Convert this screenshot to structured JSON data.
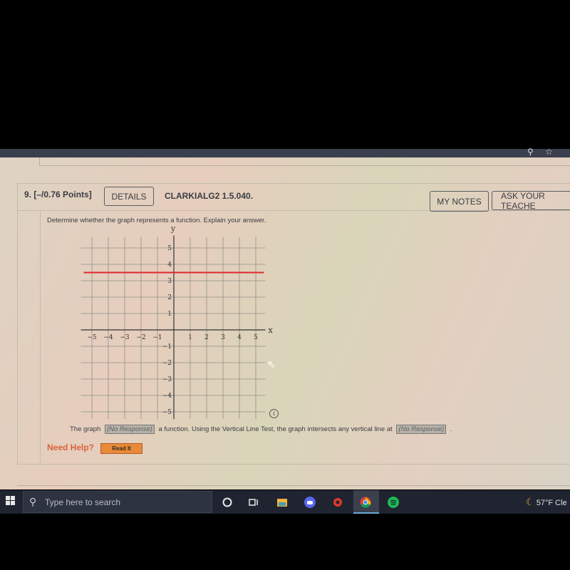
{
  "browser": {
    "icons": [
      "search-icon",
      "star-icon"
    ]
  },
  "question": {
    "number": "9.",
    "points": "[–/0.76 Points]",
    "details_label": "DETAILS",
    "code": "CLARKIALG2 1.5.040.",
    "my_notes_label": "MY NOTES",
    "ask_teacher_label": "ASK YOUR TEACHE",
    "prompt": "Determine whether the graph represents a function. Explain your answer.",
    "sentence_part1": "The graph",
    "blank1": "(No Response)",
    "sentence_part2": "a function. Using the Vertical Line Test, the graph intersects any vertical line at",
    "blank2": "(No Response)",
    "sentence_end": ".",
    "need_help": "Need Help?",
    "read_it": "Read It",
    "info_glyph": "i"
  },
  "chart_data": {
    "type": "line",
    "title": "",
    "xlabel": "x",
    "ylabel": "y",
    "xlim": [
      -5.5,
      5.5
    ],
    "ylim": [
      -5.5,
      5.5
    ],
    "grid": true,
    "x_ticks": [
      -5,
      -4,
      -3,
      -2,
      -1,
      1,
      2,
      3,
      4,
      5
    ],
    "y_ticks": [
      5,
      4,
      3,
      2,
      1,
      -1,
      -2,
      -3,
      -4,
      -5
    ],
    "x_tick_labels": [
      "−5",
      "−4",
      "−3",
      "−2",
      "−1",
      "1",
      "2",
      "3",
      "4",
      "5"
    ],
    "y_tick_labels": [
      "5",
      "4",
      "3",
      "2",
      "1",
      "−1",
      "−2",
      "−3",
      "−4",
      "−5"
    ],
    "series": [
      {
        "name": "horizontal line",
        "color": "#e0282c",
        "x": [
          -5.5,
          5.5
        ],
        "y": [
          3.5,
          3.5
        ]
      }
    ]
  },
  "taskbar": {
    "search_placeholder": "Type here to search",
    "apps": [
      "cortana-circle",
      "task-view",
      "file-explorer",
      "discord",
      "origin",
      "chrome",
      "spotify"
    ],
    "weather": "57°F Cle"
  }
}
